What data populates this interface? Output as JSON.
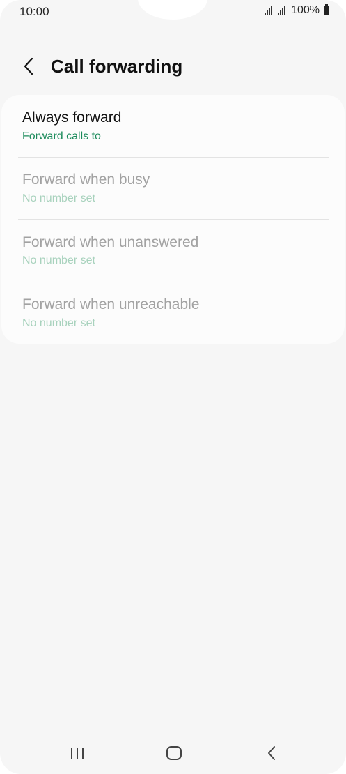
{
  "status_bar": {
    "time": "10:00",
    "battery": "100%",
    "icons": [
      "signal-icon",
      "signal-icon",
      "battery-icon"
    ]
  },
  "header": {
    "title": "Call forwarding",
    "back_icon": "chevron-left-icon"
  },
  "items": [
    {
      "title": "Always forward",
      "subtitle": "Forward calls to",
      "enabled": true
    },
    {
      "title": "Forward when busy",
      "subtitle": "No number set",
      "enabled": false
    },
    {
      "title": "Forward when unanswered",
      "subtitle": "No number set",
      "enabled": false
    },
    {
      "title": "Forward when unreachable",
      "subtitle": "No number set",
      "enabled": false
    }
  ],
  "nav_bar": {
    "icons": [
      "recents-icon",
      "home-icon",
      "back-icon"
    ]
  },
  "colors": {
    "accent": "#1a8a5a",
    "disabled_text": "#a2a2a2",
    "disabled_subtext": "#a8d2bd",
    "background": "#f6f6f6",
    "card": "#fcfcfc"
  }
}
